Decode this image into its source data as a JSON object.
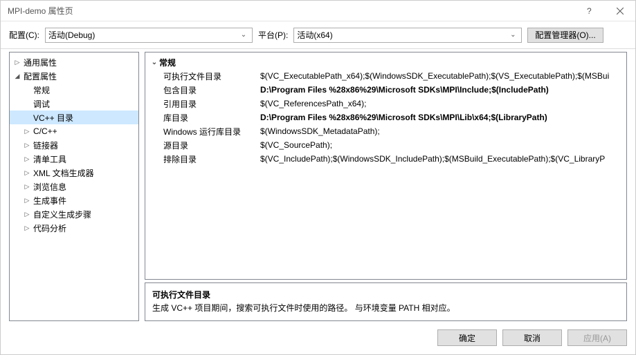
{
  "titlebar": {
    "title": "MPI-demo 属性页"
  },
  "toolbar": {
    "config_label": "配置(C):",
    "config_value": "活动(Debug)",
    "platform_label": "平台(P):",
    "platform_value": "活动(x64)",
    "config_mgr": "配置管理器(O)..."
  },
  "tree": [
    {
      "label": "通用属性",
      "depth": 0,
      "toggle": "▷"
    },
    {
      "label": "配置属性",
      "depth": 0,
      "toggle": "◢"
    },
    {
      "label": "常规",
      "depth": 1,
      "toggle": ""
    },
    {
      "label": "调试",
      "depth": 1,
      "toggle": ""
    },
    {
      "label": "VC++ 目录",
      "depth": 1,
      "toggle": "",
      "selected": true
    },
    {
      "label": "C/C++",
      "depth": 1,
      "toggle": "▷"
    },
    {
      "label": "链接器",
      "depth": 1,
      "toggle": "▷"
    },
    {
      "label": "清单工具",
      "depth": 1,
      "toggle": "▷"
    },
    {
      "label": "XML 文档生成器",
      "depth": 1,
      "toggle": "▷"
    },
    {
      "label": "浏览信息",
      "depth": 1,
      "toggle": "▷"
    },
    {
      "label": "生成事件",
      "depth": 1,
      "toggle": "▷"
    },
    {
      "label": "自定义生成步骤",
      "depth": 1,
      "toggle": "▷"
    },
    {
      "label": "代码分析",
      "depth": 1,
      "toggle": "▷"
    }
  ],
  "group": {
    "toggle": "⌄",
    "label": "常规"
  },
  "props": [
    {
      "name": "可执行文件目录",
      "value": "$(VC_ExecutablePath_x64);$(WindowsSDK_ExecutablePath);$(VS_ExecutablePath);$(MSBui",
      "bold": false
    },
    {
      "name": "包含目录",
      "value": "D:\\Program Files %28x86%29\\Microsoft SDKs\\MPI\\Include;$(IncludePath)",
      "bold": true
    },
    {
      "name": "引用目录",
      "value": "$(VC_ReferencesPath_x64);",
      "bold": false
    },
    {
      "name": "库目录",
      "value": "D:\\Program Files %28x86%29\\Microsoft SDKs\\MPI\\Lib\\x64;$(LibraryPath)",
      "bold": true
    },
    {
      "name": "Windows 运行库目录",
      "value": "$(WindowsSDK_MetadataPath);",
      "bold": false
    },
    {
      "name": "源目录",
      "value": "$(VC_SourcePath);",
      "bold": false
    },
    {
      "name": "排除目录",
      "value": "$(VC_IncludePath);$(WindowsSDK_IncludePath);$(MSBuild_ExecutablePath);$(VC_LibraryP",
      "bold": false
    }
  ],
  "desc": {
    "title": "可执行文件目录",
    "text": "生成 VC++ 项目期间，搜索可执行文件时使用的路径。  与环境变量 PATH 相对应。"
  },
  "footer": {
    "ok": "确定",
    "cancel": "取消",
    "apply": "应用(A)"
  }
}
